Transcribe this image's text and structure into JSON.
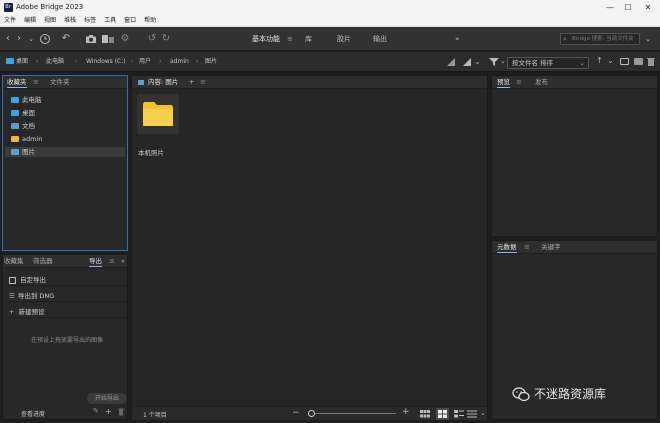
{
  "app": {
    "title": "Adobe Bridge 2023",
    "logo_text": "Br",
    "window_controls": [
      "—",
      "☐",
      "✕"
    ]
  },
  "menu": [
    "文件",
    "编辑",
    "视图",
    "堆栈",
    "标签",
    "工具",
    "窗口",
    "帮助"
  ],
  "toolbar": {
    "workspaces": [
      "基本功能",
      "库",
      "胶片",
      "输出"
    ],
    "workspace_menu": "≡",
    "overflow": "»",
    "search_placeholder": "Bridge 搜索: 当前文件夹"
  },
  "path": {
    "crumbs": [
      "桌面",
      "此电脑",
      "Windows (C:)",
      "用户",
      "admin",
      "图片"
    ],
    "sort_label": "按文件名 排序"
  },
  "favorites": {
    "tabs": [
      "收藏夹",
      "文件夹"
    ],
    "items": [
      {
        "label": "此电脑",
        "icon": "computer-icon",
        "color": "#3ba3e0"
      },
      {
        "label": "桌面",
        "icon": "desktop-icon",
        "color": "#3ba3e0"
      },
      {
        "label": "文档",
        "icon": "documents-icon",
        "color": "#5aa0d8"
      },
      {
        "label": "admin",
        "icon": "folder-icon",
        "color": "#e8b84a"
      },
      {
        "label": "图片",
        "icon": "pictures-icon",
        "color": "#5aa0d8"
      }
    ]
  },
  "collections": {
    "tabs": [
      "收藏集",
      "筛选器",
      "导出"
    ],
    "rows": [
      "自定导出",
      "导出到 DNG",
      "新建预设"
    ],
    "hint": "在预设上拖放要导出的图像",
    "start_button": "开始导出",
    "progress_label": "查看进度"
  },
  "content": {
    "header": "内容: 图片",
    "folder_label": "本机照片",
    "status": "1 个项目"
  },
  "preview": {
    "tabs": [
      "预览",
      "发布"
    ]
  },
  "metadata": {
    "tabs": [
      "元数据",
      "关键字"
    ]
  },
  "watermark": {
    "text": "不迷路资源库"
  },
  "colors": {
    "accent": "#8fb3ff",
    "folder": "#f2c230",
    "panel_bg": "#282828"
  }
}
